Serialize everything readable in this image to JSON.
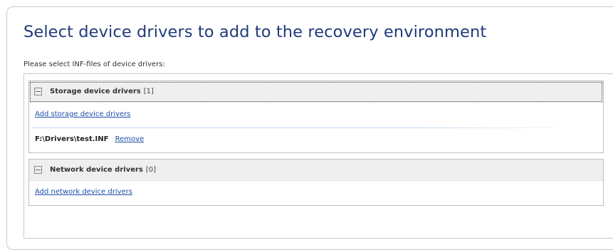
{
  "title": "Select device drivers to add to the recovery environment",
  "subtitle": "Please select INF-files of device drivers:",
  "groups": [
    {
      "name": "Storage device drivers",
      "count": "[1]",
      "add_link": "Add storage device drivers",
      "drivers": [
        {
          "path": "F:\\Drivers\\test.INF",
          "remove_label": "Remove"
        }
      ]
    },
    {
      "name": "Network device drivers",
      "count": "[0]",
      "add_link": "Add network device drivers",
      "drivers": []
    }
  ],
  "colors": {
    "title": "#1f3b7a",
    "link": "#1f4fa8",
    "group_header_bg": "#efefef"
  }
}
